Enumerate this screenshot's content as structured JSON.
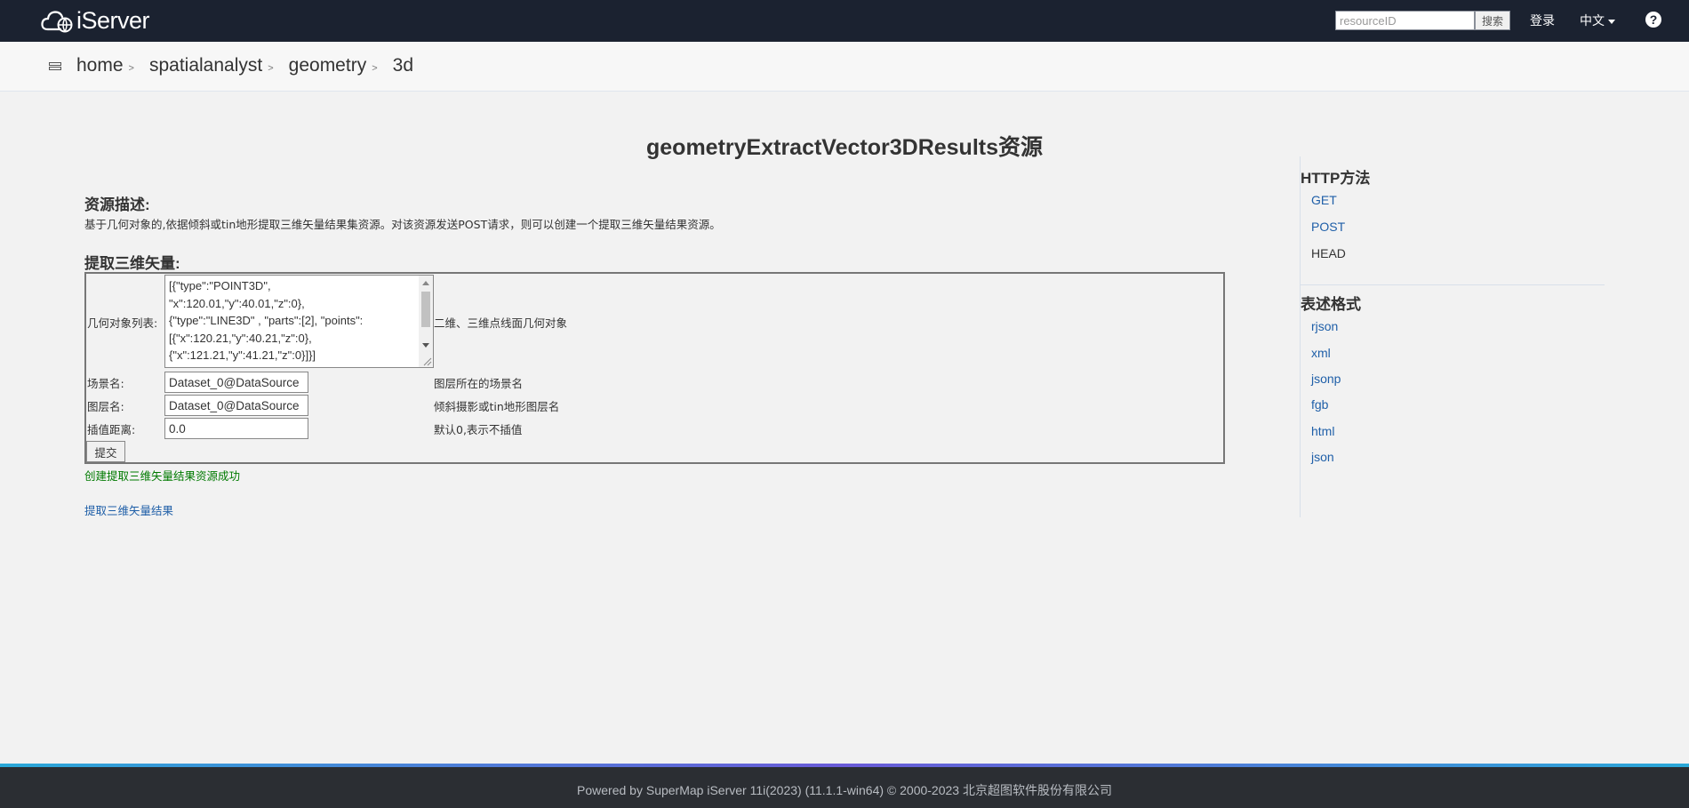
{
  "navbar": {
    "logo_text": "iServer",
    "search_placeholder": "resourceID",
    "search_button": "搜索",
    "login": "登录",
    "language": "中文",
    "help": "?"
  },
  "breadcrumb": {
    "items": [
      "home",
      "spatialanalyst",
      "geometry",
      "3d"
    ],
    "separator": ">"
  },
  "page": {
    "title": "geometryExtractVector3DResults资源",
    "desc_heading": "资源描述:",
    "desc_text": "基于几何对象的,依据倾斜或tin地形提取三维矢量结果集资源。对该资源发送POST请求，则可以创建一个提取三维矢量结果资源。",
    "form_heading": "提取三维矢量:"
  },
  "form": {
    "geometries_label": "几何对象列表:",
    "geometries_value": "[{\"type\":\"POINT3D\",\n\"x\":120.01,\"y\":40.01,\"z\":0},\n{\"type\":\"LINE3D\" , \"parts\":[2], \"points\":\n[{\"x\":120.21,\"y\":40.21,\"z\":0},\n{\"x\":121.21,\"y\":41.21,\"z\":0}]}]",
    "geometries_hint": "二维、三维点线面几何对象",
    "scene_label": "场景名:",
    "scene_value": "Dataset_0@DataSource",
    "scene_hint": "图层所在的场景名",
    "layer_label": "图层名:",
    "layer_value": "Dataset_0@DataSource",
    "layer_hint": "倾斜摄影或tin地形图层名",
    "interval_label": "插值距离:",
    "interval_value": "0.0",
    "interval_hint": "默认0,表示不插值",
    "submit_label": "提交"
  },
  "status": {
    "success_message": "创建提取三维矢量结果资源成功",
    "result_link": "提取三维矢量结果"
  },
  "sidebar": {
    "http_heading": "HTTP方法",
    "methods": [
      "GET",
      "POST",
      "HEAD"
    ],
    "format_heading": "表述格式",
    "formats": [
      "rjson",
      "xml",
      "jsonp",
      "fgb",
      "html",
      "json"
    ]
  },
  "footer": {
    "text": "Powered by SuperMap iServer 11i(2023) (11.1.1-win64) © 2000-2023 北京超图软件股份有限公司"
  }
}
